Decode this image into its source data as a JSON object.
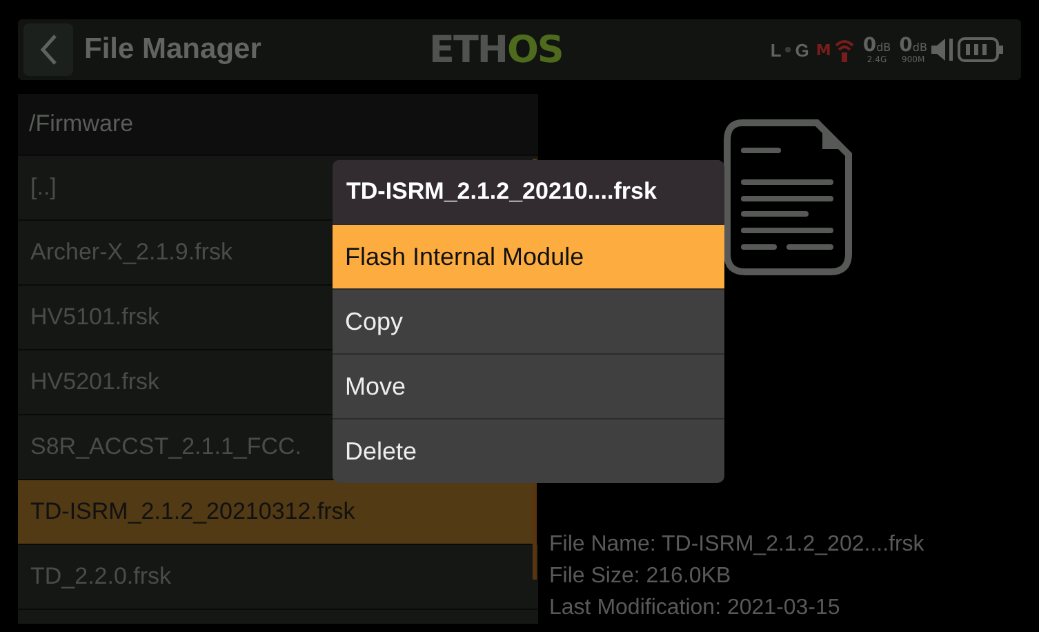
{
  "header": {
    "title": "File Manager",
    "logo": [
      "ETH",
      "OS"
    ],
    "status": {
      "left_marker": "L",
      "gps_marker": "G",
      "module_mark": "M",
      "rssi": [
        {
          "value": "0",
          "unit": "dB",
          "band": "2.4G"
        },
        {
          "value": "0",
          "unit": "dB",
          "band": "900M"
        }
      ]
    }
  },
  "file_list": {
    "path": "/Firmware",
    "items": [
      {
        "name": "[..]",
        "selected": false
      },
      {
        "name": "Archer-X_2.1.9.frsk",
        "selected": false
      },
      {
        "name": "HV5101.frsk",
        "selected": false
      },
      {
        "name": "HV5201.frsk",
        "selected": false
      },
      {
        "name": "S8R_ACCST_2.1.1_FCC.",
        "selected": false
      },
      {
        "name": "TD-ISRM_2.1.2_20210312.frsk",
        "selected": true
      },
      {
        "name": "TD_2.2.0.frsk",
        "selected": false
      }
    ]
  },
  "details": [
    "File Name: TD-ISRM_2.1.2_202....frsk",
    "File Size: 216.0KB",
    "Last Modification: 2021-03-15"
  ],
  "popup": {
    "title": "TD-ISRM_2.1.2_20210....frsk",
    "items": [
      {
        "label": "Flash Internal Module",
        "selected": true
      },
      {
        "label": "Copy",
        "selected": false
      },
      {
        "label": "Move",
        "selected": false
      },
      {
        "label": "Delete",
        "selected": false
      }
    ]
  }
}
